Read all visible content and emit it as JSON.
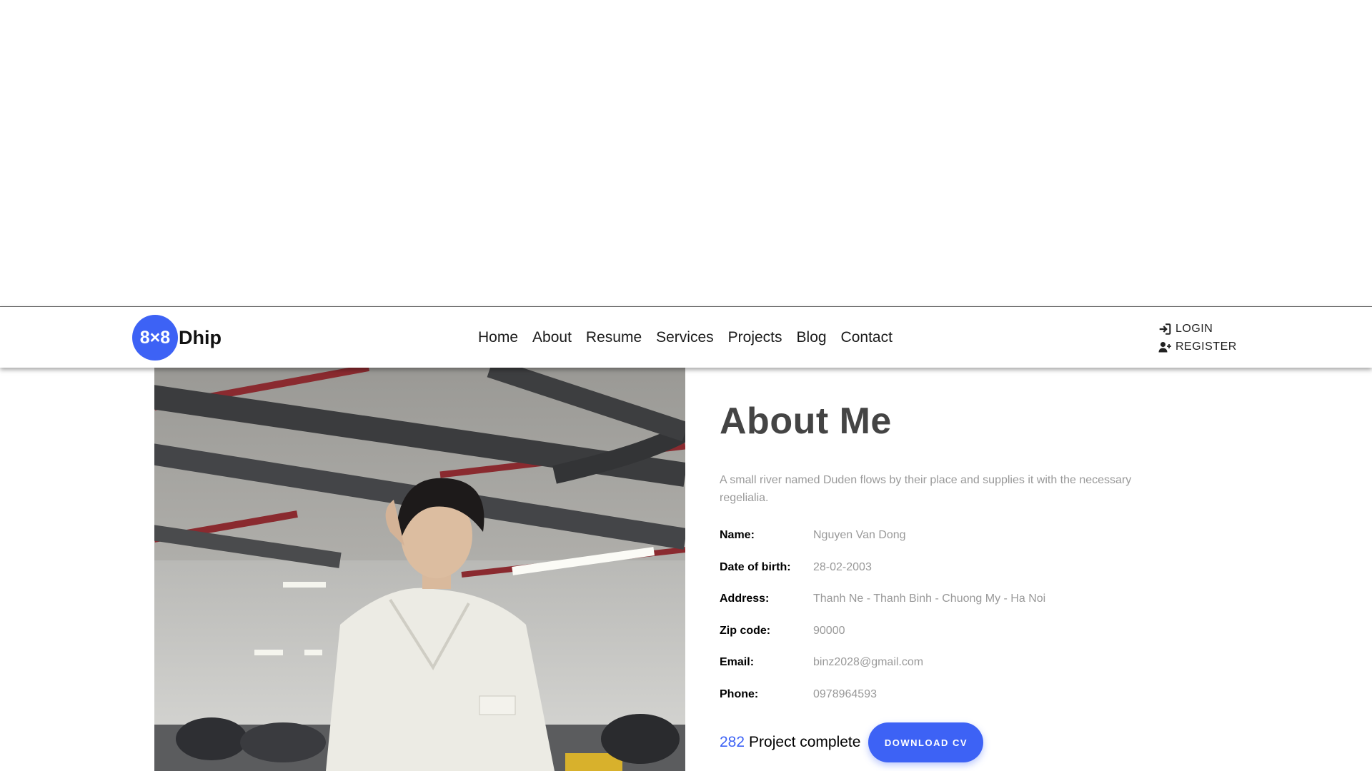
{
  "brand": {
    "badge": "8×8",
    "name": "Dhip",
    "accent_color": "#3d62f5"
  },
  "nav": {
    "items": [
      "Home",
      "About",
      "Resume",
      "Services",
      "Projects",
      "Blog",
      "Contact"
    ]
  },
  "auth": {
    "login_label": "LOGIN",
    "login_icon": "sign-in-icon",
    "register_label": "REGISTER",
    "register_icon": "user-plus-icon"
  },
  "photo": {
    "subject": "portrait-photo"
  },
  "about": {
    "title": "About Me",
    "description": "A small river named Duden flows by their place and supplies it with the necessary regelialia.",
    "info": [
      {
        "label": "Name:",
        "value": "Nguyen Van Dong"
      },
      {
        "label": "Date of birth:",
        "value": "28-02-2003"
      },
      {
        "label": "Address:",
        "value": "Thanh Ne - Thanh Binh - Chuong My - Ha Noi"
      },
      {
        "label": "Zip code:",
        "value": "90000"
      },
      {
        "label": "Email:",
        "value": "binz2028@gmail.com"
      },
      {
        "label": "Phone:",
        "value": "0978964593"
      }
    ],
    "project_count": "282",
    "project_label": "Project complete",
    "download_label": "DOWNLOAD CV"
  }
}
